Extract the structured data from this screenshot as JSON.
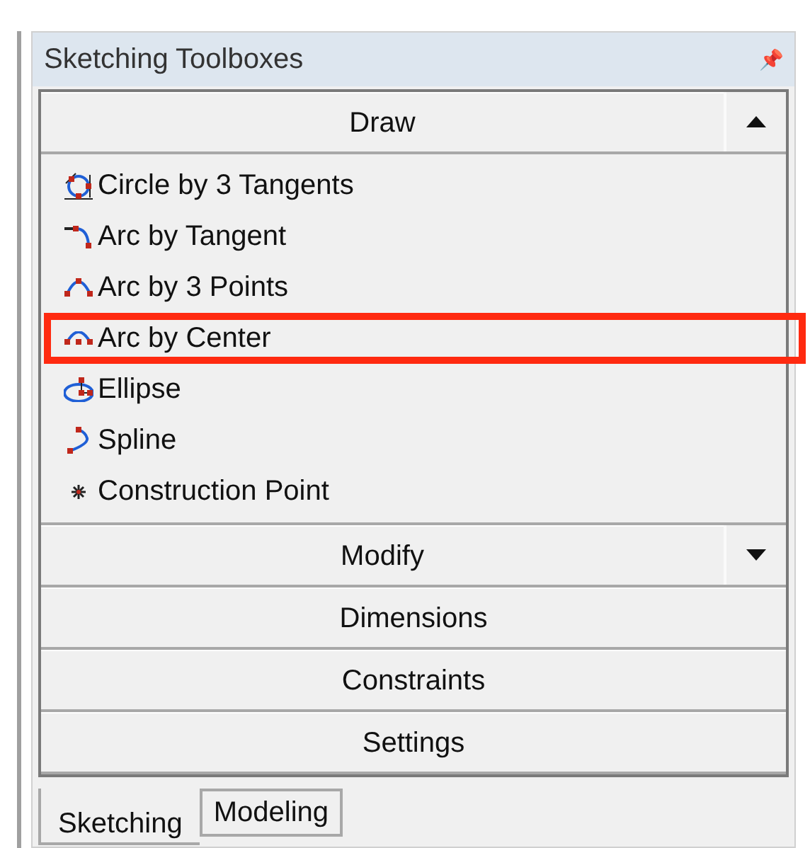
{
  "panel": {
    "title": "Sketching Toolboxes",
    "pin_glyph": "📌"
  },
  "sections": [
    {
      "label": "Draw",
      "expanded": true,
      "items": [
        {
          "label": "Circle by 3 Tangents",
          "highlighted": false
        },
        {
          "label": "Arc by Tangent",
          "highlighted": false
        },
        {
          "label": "Arc by 3 Points",
          "highlighted": false
        },
        {
          "label": "Arc by Center",
          "highlighted": true
        },
        {
          "label": "Ellipse",
          "highlighted": false
        },
        {
          "label": "Spline",
          "highlighted": false
        },
        {
          "label": "Construction Point",
          "highlighted": false
        }
      ]
    },
    {
      "label": "Modify",
      "expanded": false
    },
    {
      "label": "Dimensions"
    },
    {
      "label": "Constraints"
    },
    {
      "label": "Settings"
    }
  ],
  "tabs": [
    {
      "label": "Sketching",
      "selected": true
    },
    {
      "label": "Modeling",
      "selected": false
    }
  ]
}
